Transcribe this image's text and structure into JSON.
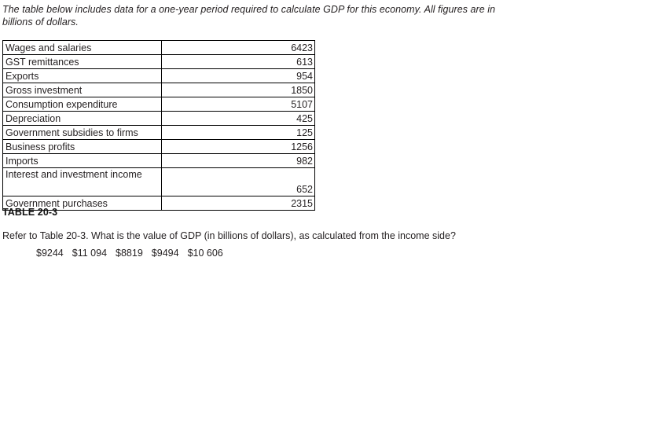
{
  "intro": {
    "text": "The table below includes data for a one-year period required to calculate GDP for this economy. All figures are in billions of dollars."
  },
  "table": {
    "caption": "TABLE 20-3",
    "rows": [
      {
        "label": "Wages and salaries",
        "value": "6423"
      },
      {
        "label": "GST remittances",
        "value": "613"
      },
      {
        "label": "Exports",
        "value": "954"
      },
      {
        "label": "Gross investment",
        "value": "1850"
      },
      {
        "label": "Consumption expenditure",
        "value": "5107"
      },
      {
        "label": "Depreciation",
        "value": "425"
      },
      {
        "label": "Government subsidies to firms",
        "value": "125"
      },
      {
        "label": "Business profits",
        "value": "1256"
      },
      {
        "label": "Imports",
        "value": "982"
      },
      {
        "label": "Interest and investment income",
        "value": "652"
      },
      {
        "label": "Government purchases",
        "value": "2315"
      }
    ]
  },
  "question": {
    "text": "Refer to Table 20-3. What is the value of GDP (in billions of dollars), as calculated from the income side?",
    "options": [
      {
        "label": "$9244"
      },
      {
        "label": "$11 094"
      },
      {
        "label": "$8819"
      },
      {
        "label": "$9494"
      },
      {
        "label": "$10 606"
      }
    ]
  },
  "colors": {
    "text": "#231f20",
    "border": "#000000",
    "background": "#ffffff"
  }
}
